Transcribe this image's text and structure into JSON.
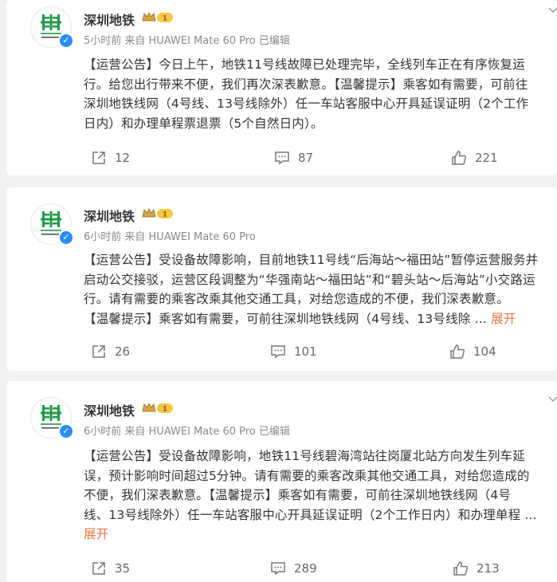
{
  "posts": [
    {
      "name": "深圳地铁",
      "meta": "5小时前  来自 HUAWEI Mate 60 Pro 已编辑",
      "lines": [
        "【运营公告】今日上午，地铁11号线故障已处理完毕，全线列车正在有序恢复运",
        "行。给您出行带来不便，我们再次深表歉意。【温馨提示】乘客如有需要，可前往",
        "深圳地铁线网（4号线、13号线除外）任一车站客服中心开具延误证明（2个工作",
        "日内）和办理单程票退票（5个自然日内）。"
      ],
      "expand": "",
      "repost": "12",
      "comment": "87",
      "like": "221"
    },
    {
      "name": "深圳地铁",
      "meta": "6小时前  来自 HUAWEI Mate 60 Pro",
      "lines": [
        "【运营公告】受设备故障影响，目前地铁11号线“后海站～福田站”暂停运营服务并",
        "启动公交接驳，运营区段调整为“华强南站～福田站”和“碧头站～后海站”小交路运",
        "行。请有需要的乘客改乘其他交通工具，对给您造成的不便，我们深表歉意。",
        "【温馨提示】乘客如有需要，可前往深圳地铁线网（4号线、13号线除 ... "
      ],
      "expand": "展开",
      "repost": "26",
      "comment": "101",
      "like": "104"
    },
    {
      "name": "深圳地铁",
      "meta": "6小时前  来自 HUAWEI Mate 60 Pro 已编辑",
      "lines": [
        "【运营公告】受设备故障影响，地铁11号线碧海湾站往岗厦北站方向发生列车延",
        "误，预计影响时间超过5分钟。请有需要的乘客改乘其他交通工具，对给您造成的",
        "不便，我们深表歉意。【温馨提示】乘客如有需要，可前往深圳地铁线网（4号",
        "线、13号线除外）任一车站客服中心开具延误证明（2个工作日内）和办理单程 ..."
      ],
      "expand": "展开",
      "repost": "35",
      "comment": "289",
      "like": "213"
    }
  ],
  "colors": {
    "logo_green": "#1d9a4a",
    "expand": "#eb7340",
    "verified": "#2b8cf5"
  },
  "icons": [
    "shenzhen-metro-logo",
    "verified-badge-icon",
    "vip-crown-icon",
    "more-chevron-icon",
    "repost-icon",
    "comment-icon",
    "like-icon"
  ]
}
